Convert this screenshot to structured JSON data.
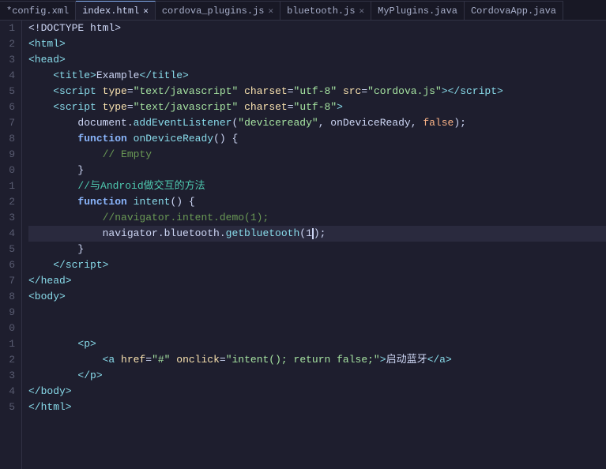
{
  "tabs": [
    {
      "id": "config",
      "label": "*config.xml",
      "active": false,
      "closable": false
    },
    {
      "id": "index",
      "label": "index.html",
      "active": true,
      "closable": true
    },
    {
      "id": "cordova",
      "label": "cordova_plugins.js",
      "active": false,
      "closable": true
    },
    {
      "id": "bluetooth",
      "label": "bluetooth.js",
      "active": false,
      "closable": true
    },
    {
      "id": "myplugins",
      "label": "MyPlugins.java",
      "active": false,
      "closable": false
    },
    {
      "id": "cordovaapp",
      "label": "CordovaApp.java",
      "active": false,
      "closable": false
    }
  ],
  "lines": [
    {
      "num": "1",
      "highlighted": false
    },
    {
      "num": "2",
      "highlighted": false
    },
    {
      "num": "3",
      "highlighted": false
    },
    {
      "num": "4",
      "highlighted": false
    },
    {
      "num": "5",
      "highlighted": false
    },
    {
      "num": "6",
      "highlighted": false
    },
    {
      "num": "7",
      "highlighted": false
    },
    {
      "num": "8",
      "highlighted": false
    },
    {
      "num": "9",
      "highlighted": false
    },
    {
      "num": "0",
      "highlighted": false
    },
    {
      "num": "1",
      "highlighted": false
    },
    {
      "num": "2",
      "highlighted": false
    },
    {
      "num": "3",
      "highlighted": false
    },
    {
      "num": "4",
      "highlighted": true
    },
    {
      "num": "5",
      "highlighted": false
    },
    {
      "num": "6",
      "highlighted": false
    },
    {
      "num": "7",
      "highlighted": false
    },
    {
      "num": "8",
      "highlighted": false
    },
    {
      "num": "9",
      "highlighted": false
    },
    {
      "num": "0",
      "highlighted": false
    },
    {
      "num": "1",
      "highlighted": false
    },
    {
      "num": "2",
      "highlighted": false
    },
    {
      "num": "3",
      "highlighted": false
    },
    {
      "num": "4",
      "highlighted": false
    },
    {
      "num": "5",
      "highlighted": false
    }
  ]
}
